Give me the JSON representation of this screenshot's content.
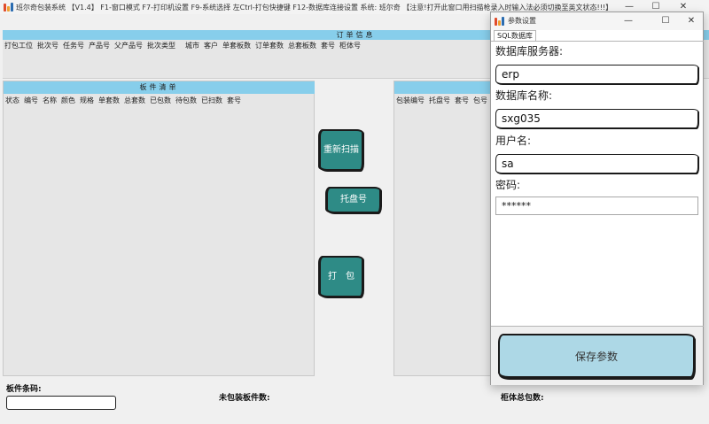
{
  "main_window": {
    "title": "班尔奇包装系统 【V1.4】 F1-窗口模式 F7-打印机设置 F9-系统选择 左Ctrl-打包快捷键 F12-数据库连接设置 系统: 班尔奇 【注意!打开此窗口用扫描枪录入时输入法必须切换至英文状态!!!】",
    "controls": {
      "minimize": "—",
      "maximize": "☐",
      "close": "✕"
    }
  },
  "order_panel": {
    "header": "订单信息",
    "columns": [
      "打包工位",
      "批次号",
      "任务号",
      "产品号",
      "父产品号",
      "批次类型",
      "城市",
      "客户",
      "单套板数",
      "订单套数",
      "总套板数",
      "套号",
      "柜体号"
    ]
  },
  "board_panel": {
    "header": "板件清单",
    "columns": [
      "状态",
      "编号",
      "名称",
      "颜色",
      "规格",
      "单套数",
      "总套数",
      "已包数",
      "待包数",
      "已扫数",
      "套号"
    ]
  },
  "pack_panel": {
    "columns": [
      "包装编号",
      "托盘号",
      "套号",
      "包号"
    ]
  },
  "actions": {
    "rescan": "重新扫描",
    "pallet": "托盘号",
    "pack": "打　包"
  },
  "bottom": {
    "barcode_label": "板件条码:",
    "unpacked_label": "未包装板件数:",
    "cabinet_total_label": "柜体总包数:"
  },
  "settings_dialog": {
    "title": "参数设置",
    "tab": "SQL数据库",
    "fields": [
      {
        "label": "数据库服务器:",
        "value": "erp"
      },
      {
        "label": "数据库名称:",
        "value": "sxg035"
      },
      {
        "label": "用户名:",
        "value": "sa"
      },
      {
        "label": "密码:",
        "value": "******"
      }
    ],
    "save_button": "保存参数",
    "controls": {
      "minimize": "—",
      "maximize": "☐",
      "close": "✕"
    }
  },
  "colors": {
    "panel_header": "#87ceeb",
    "action_button": "#2e8b86",
    "save_button": "#add8e6",
    "icon_red": "#e04b2a",
    "icon_orange": "#f0a030",
    "icon_blue": "#2b6cb0"
  }
}
